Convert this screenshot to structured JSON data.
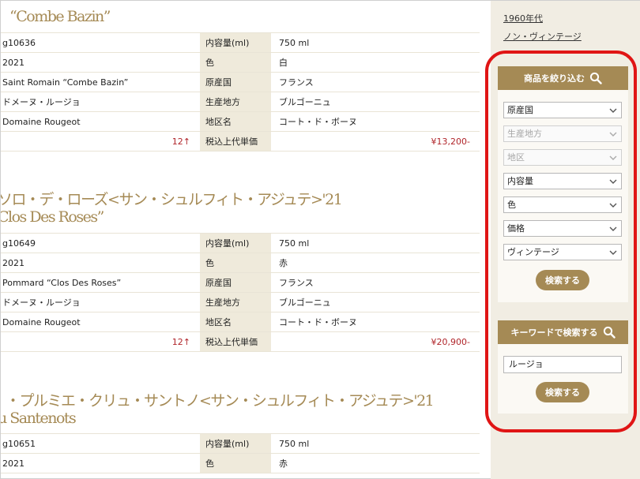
{
  "products": [
    {
      "title_lines": [
        "“Combe Bazin”"
      ],
      "rows": [
        {
          "left": "g10636",
          "label": "内容量(ml)",
          "value": "750 ml"
        },
        {
          "left": "2021",
          "label": "色",
          "value": "白"
        },
        {
          "left": "Saint Romain “Combe Bazin”",
          "label": "原産国",
          "value": "フランス"
        },
        {
          "left": "ドメーヌ・ルージョ",
          "label": "生産地方",
          "value": "ブルゴーニュ"
        },
        {
          "left": "Domaine Rougeot",
          "label": "地区名",
          "value": "コート・ド・ボーヌ"
        },
        {
          "left": "12↑",
          "label": "税込上代単価",
          "value": "¥13,200-"
        }
      ]
    },
    {
      "title_lines": [
        "ソロ・デ・ローズ<サン・シュルフィト・アジュテ>'21",
        "Clos Des Roses”"
      ],
      "rows": [
        {
          "left": "g10649",
          "label": "内容量(ml)",
          "value": "750 ml"
        },
        {
          "left": "2021",
          "label": "色",
          "value": "赤"
        },
        {
          "left": "Pommard “Clos Des Roses”",
          "label": "原産国",
          "value": "フランス"
        },
        {
          "left": "ドメーヌ・ルージョ",
          "label": "生産地方",
          "value": "ブルゴーニュ"
        },
        {
          "left": "Domaine Rougeot",
          "label": "地区名",
          "value": "コート・ド・ボーヌ"
        },
        {
          "left": "12↑",
          "label": "税込上代単価",
          "value": "¥20,900-"
        }
      ]
    },
    {
      "title_lines": [
        "・プルミエ・クリュ・サントノ<サン・シュルフィト・アジュテ>'21",
        "u Santenots"
      ],
      "rows": [
        {
          "left": "g10651",
          "label": "内容量(ml)",
          "value": "750 ml"
        },
        {
          "left": "2021",
          "label": "色",
          "value": "赤"
        }
      ]
    }
  ],
  "sidebar": {
    "links": [
      "1960年代",
      "ノン・ヴィンテージ"
    ],
    "filter_title": "商品を絞り込む",
    "filters": [
      {
        "label": "原産国",
        "disabled": false
      },
      {
        "label": "生産地方",
        "disabled": true
      },
      {
        "label": "地区",
        "disabled": true
      },
      {
        "label": "内容量",
        "disabled": false
      },
      {
        "label": "色",
        "disabled": false
      },
      {
        "label": "価格",
        "disabled": false
      },
      {
        "label": "ヴィンテージ",
        "disabled": false
      }
    ],
    "search_button": "検索する",
    "keyword_title": "キーワードで検索する",
    "keyword_value": "ルージョ",
    "keyword_button": "検索する"
  },
  "colors": {
    "accent": "#a58a55",
    "highlight_ring": "#e01515",
    "price": "#b0252a"
  }
}
